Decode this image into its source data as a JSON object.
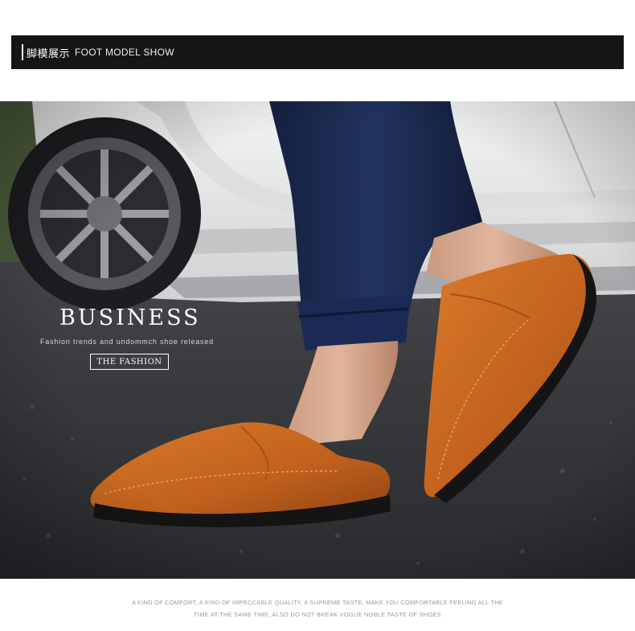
{
  "header": {
    "title_cn": "脚模展示",
    "title_en": "FOOT MODEL SHOW"
  },
  "hero": {
    "image_description_icon": "photo-foot-model-icon",
    "title": "BUSINESS",
    "subtitle": "Fashion trends and undommch shoe released",
    "badge": "THE FASHION"
  },
  "footer": {
    "line1": "A KIND OF COMFORT, A KIND OF IMPECCABLE QUALITY, A SUPREME TASTE, MAKE YOU COMFORTABLE FEELING ALL THE",
    "line2": "TIME AT THE SAME TIME, ALSO DO NOT BREAK VOGUE NOBLE TASTE OF SHOES"
  },
  "colors": {
    "header_bg": "#151515",
    "shoe_leather": "#c8651f",
    "trousers": "#1b2a52",
    "car_white": "#e9eaea",
    "asphalt": "#3a3b3f"
  }
}
